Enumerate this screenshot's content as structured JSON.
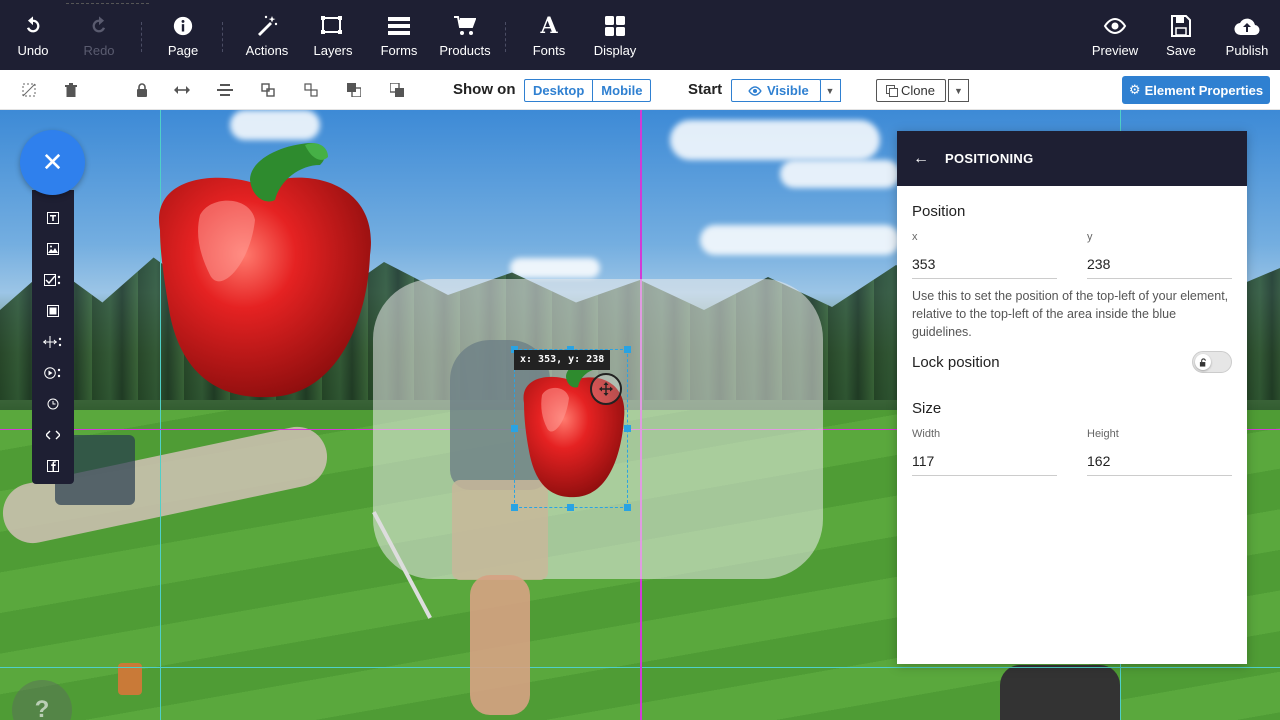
{
  "topbar": {
    "undo": "Undo",
    "redo": "Redo",
    "page": "Page",
    "actions": "Actions",
    "layers": "Layers",
    "forms": "Forms",
    "products": "Products",
    "fonts": "Fonts",
    "display": "Display",
    "preview": "Preview",
    "save": "Save",
    "publish": "Publish"
  },
  "subbar": {
    "show_on_label": "Show on",
    "show_on_options": [
      "Desktop",
      "Mobile"
    ],
    "start_label": "Start",
    "visible_option": "Visible",
    "clone_label": "Clone",
    "element_properties": "Element Properties"
  },
  "canvas": {
    "coord_readout": "x: 353, y: 238",
    "help_glyph": "?"
  },
  "panel": {
    "title": "POSITIONING",
    "position_title": "Position",
    "x_label": "x",
    "x_value": "353",
    "y_label": "y",
    "y_value": "238",
    "help_text": "Use this to set the position of the top-left of your element, relative to the top-left of the area inside the blue guidelines.",
    "lock_label": "Lock position",
    "lock_on": false,
    "size_title": "Size",
    "width_label": "Width",
    "width_value": "117",
    "height_label": "Height",
    "height_value": "162"
  },
  "colors": {
    "toolbar_bg": "#1e1f33",
    "accent_blue": "#2f80d1",
    "fab_blue": "#2f80ed",
    "guide_magenta": "#d23ad6",
    "guide_teal": "#4fd0c8",
    "selection_blue": "#29a3e3",
    "pepper_red": "#d81e1e",
    "stem_green": "#2e8b2e"
  }
}
